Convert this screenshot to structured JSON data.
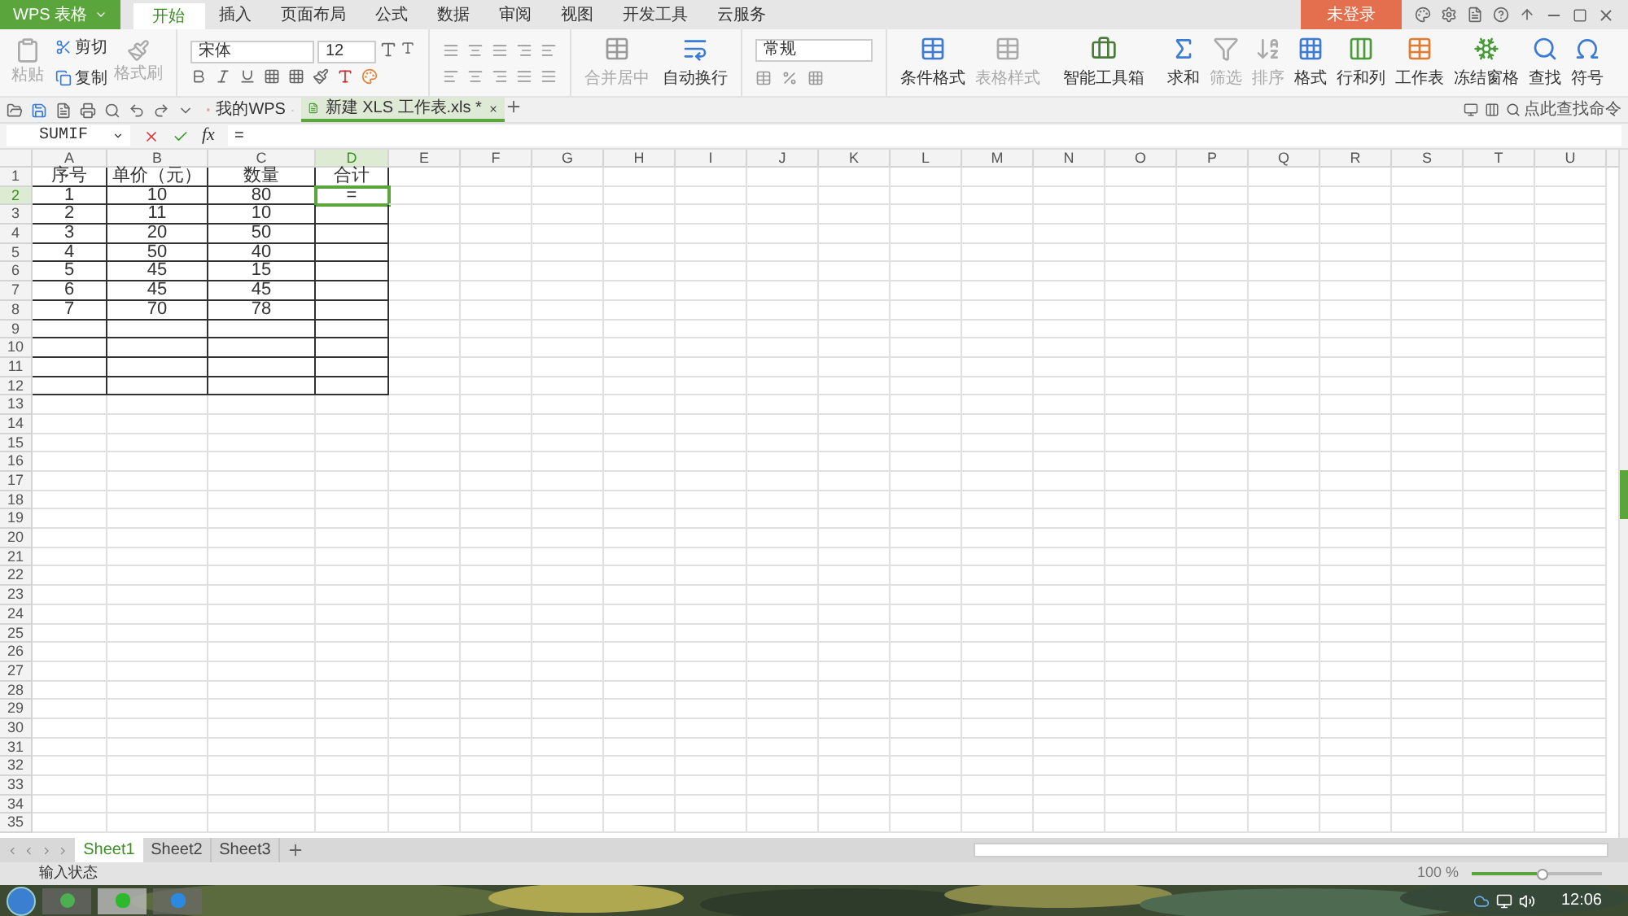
{
  "app_menu": "WPS 表格",
  "menu_tabs": [
    {
      "label": "开始",
      "selected": true
    },
    {
      "label": "插入",
      "selected": false
    },
    {
      "label": "页面布局",
      "selected": false
    },
    {
      "label": "公式",
      "selected": false
    },
    {
      "label": "数据",
      "selected": false
    },
    {
      "label": "审阅",
      "selected": false
    },
    {
      "label": "视图",
      "selected": false
    },
    {
      "label": "开发工具",
      "selected": false
    },
    {
      "label": "云服务",
      "selected": false
    }
  ],
  "login_button": "未登录",
  "clipboard": {
    "paste": {
      "label": "粘贴",
      "disabled": true
    },
    "cut": "剪切",
    "copy": "复制",
    "format_painter": {
      "label": "格式刷",
      "disabled": true
    }
  },
  "font": {
    "family": "宋体",
    "size": "12"
  },
  "merge": {
    "label": "合并居中",
    "disabled": true
  },
  "wrap": {
    "label": "自动换行",
    "disabled": false
  },
  "number_format": "常规",
  "ribbon_buttons": [
    {
      "label": "条件格式",
      "disabled": false
    },
    {
      "label": "表格样式",
      "disabled": true
    },
    {
      "label": "智能工具箱",
      "disabled": false
    },
    {
      "label": "求和",
      "disabled": false
    },
    {
      "label": "筛选",
      "disabled": true
    },
    {
      "label": "排序",
      "disabled": true
    },
    {
      "label": "格式",
      "disabled": false
    },
    {
      "label": "行和列",
      "disabled": false
    },
    {
      "label": "工作表",
      "disabled": false
    },
    {
      "label": "冻结窗格",
      "disabled": false
    },
    {
      "label": "查找",
      "disabled": false
    },
    {
      "label": "符号",
      "disabled": false
    }
  ],
  "doc_tabs": [
    {
      "label": "我的WPS",
      "selected": false
    },
    {
      "label": "新建 XLS 工作表.xls *",
      "selected": true
    }
  ],
  "command_search": {
    "placeholder": "点此查找命令"
  },
  "formula_bar": {
    "name_box": "SUMIF",
    "fx": "fx",
    "formula": "="
  },
  "columns": [
    {
      "label": "A",
      "selected": false
    },
    {
      "label": "B",
      "selected": false
    },
    {
      "label": "C",
      "selected": false
    },
    {
      "label": "D",
      "selected": true
    },
    {
      "label": "E",
      "selected": false
    },
    {
      "label": "F",
      "selected": false
    },
    {
      "label": "G",
      "selected": false
    },
    {
      "label": "H",
      "selected": false
    },
    {
      "label": "I",
      "selected": false
    },
    {
      "label": "J",
      "selected": false
    },
    {
      "label": "K",
      "selected": false
    },
    {
      "label": "L",
      "selected": false
    },
    {
      "label": "M",
      "selected": false
    },
    {
      "label": "N",
      "selected": false
    },
    {
      "label": "O",
      "selected": false
    },
    {
      "label": "P",
      "selected": false
    },
    {
      "label": "Q",
      "selected": false
    },
    {
      "label": "R",
      "selected": false
    },
    {
      "label": "S",
      "selected": false
    },
    {
      "label": "T",
      "selected": false
    },
    {
      "label": "U",
      "selected": false
    }
  ],
  "rows": [
    {
      "label": "1",
      "selected": false,
      "bordered": true,
      "cells": [
        "序号",
        "单价（元）",
        "数量",
        "合计"
      ]
    },
    {
      "label": "2",
      "selected": true,
      "bordered": true,
      "cells": [
        "1",
        "10",
        "80",
        "="
      ]
    },
    {
      "label": "3",
      "selected": false,
      "bordered": true,
      "cells": [
        "2",
        "11",
        "10"
      ]
    },
    {
      "label": "4",
      "selected": false,
      "bordered": true,
      "cells": [
        "3",
        "20",
        "50"
      ]
    },
    {
      "label": "5",
      "selected": false,
      "bordered": true,
      "cells": [
        "4",
        "50",
        "40"
      ]
    },
    {
      "label": "6",
      "selected": false,
      "bordered": true,
      "cells": [
        "5",
        "45",
        "15"
      ]
    },
    {
      "label": "7",
      "selected": false,
      "bordered": true,
      "cells": [
        "6",
        "45",
        "45"
      ]
    },
    {
      "label": "8",
      "selected": false,
      "bordered": true,
      "cells": [
        "7",
        "70",
        "78"
      ]
    },
    {
      "label": "9",
      "selected": false,
      "bordered": true
    },
    {
      "label": "10",
      "selected": false,
      "bordered": true
    },
    {
      "label": "11",
      "selected": false,
      "bordered": true
    },
    {
      "label": "12",
      "selected": false,
      "bordered": true
    },
    {
      "label": "13",
      "selected": false,
      "bordered": false
    },
    {
      "label": "14",
      "selected": false,
      "bordered": false
    },
    {
      "label": "15",
      "selected": false,
      "bordered": false
    },
    {
      "label": "16",
      "selected": false,
      "bordered": false
    },
    {
      "label": "17",
      "selected": false,
      "bordered": false
    },
    {
      "label": "18",
      "selected": false,
      "bordered": false
    },
    {
      "label": "19",
      "selected": false,
      "bordered": false
    },
    {
      "label": "20",
      "selected": false,
      "bordered": false
    },
    {
      "label": "21",
      "selected": false,
      "bordered": false
    },
    {
      "label": "22",
      "selected": false,
      "bordered": false
    },
    {
      "label": "23",
      "selected": false,
      "bordered": false
    },
    {
      "label": "24",
      "selected": false,
      "bordered": false
    },
    {
      "label": "25",
      "selected": false,
      "bordered": false
    },
    {
      "label": "26",
      "selected": false,
      "bordered": false
    },
    {
      "label": "27",
      "selected": false,
      "bordered": false
    },
    {
      "label": "28",
      "selected": false,
      "bordered": false
    },
    {
      "label": "29",
      "selected": false,
      "bordered": false
    },
    {
      "label": "30",
      "selected": false,
      "bordered": false
    },
    {
      "label": "31",
      "selected": false,
      "bordered": false
    },
    {
      "label": "32",
      "selected": false,
      "bordered": false
    },
    {
      "label": "33",
      "selected": false,
      "bordered": false
    },
    {
      "label": "34",
      "selected": false,
      "bordered": false
    },
    {
      "label": "35",
      "selected": false,
      "bordered": false
    }
  ],
  "sheet_tabs": [
    {
      "label": "Sheet1",
      "selected": true
    },
    {
      "label": "Sheet2",
      "selected": false
    },
    {
      "label": "Sheet3",
      "selected": false
    }
  ],
  "status_bar": {
    "mode": "输入状态",
    "zoom": "100 %",
    "zoom_slider": {
      "level": 0.5
    }
  },
  "taskbar": {
    "clock": "12:06"
  }
}
